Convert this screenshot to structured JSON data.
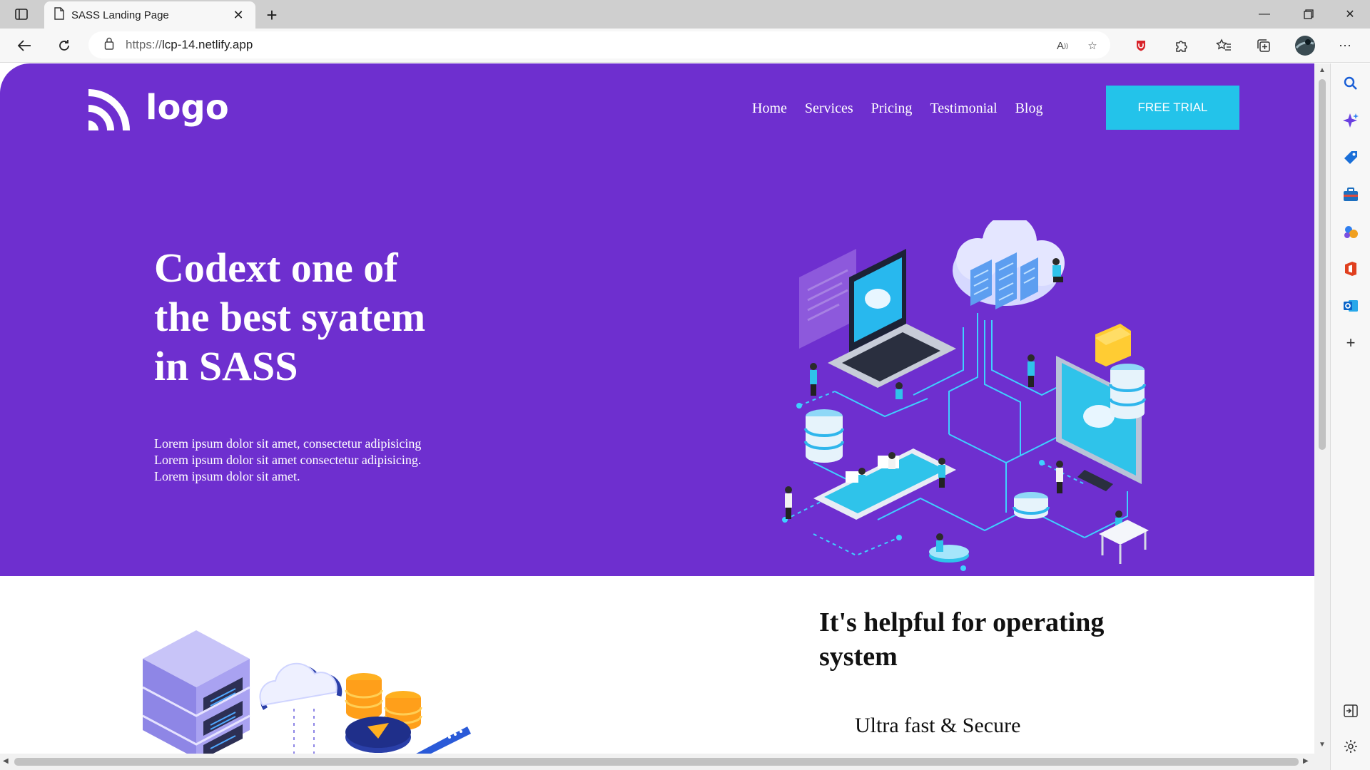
{
  "browser": {
    "tab_title": "SASS Landing Page",
    "url_protocol": "https://",
    "url_host": "lcp-14.netlify.app",
    "icons": [
      "tab-actions-icon",
      "page-icon",
      "close-icon",
      "new-tab-icon",
      "minimize-icon",
      "restore-icon",
      "window-close-icon",
      "back-icon",
      "refresh-icon",
      "lock-icon",
      "read-aloud-icon",
      "add-favorite-icon",
      "shield-extension-icon",
      "extensions-icon",
      "favorites-icon",
      "collections-icon",
      "profile-avatar",
      "more-icon"
    ]
  },
  "sidebar": {
    "icons": [
      "search-icon",
      "copilot-icon",
      "shopping-tag-icon",
      "tools-icon",
      "games-icon",
      "office-icon",
      "outlook-icon",
      "add-icon",
      "hide-sidebar-icon",
      "settings-icon"
    ]
  },
  "site": {
    "logo_text": "logo",
    "nav": [
      "Home",
      "Services",
      "Pricing",
      "Testimonial",
      "Blog"
    ],
    "cta_label": "FREE TRIAL",
    "hero": {
      "headline_lines": [
        "Codext one of",
        "the best syatem",
        "in SASS"
      ],
      "lede_lines": [
        "Lorem ipsum dolor sit amet, consectetur adipisicing",
        "Lorem ipsum dolor sit amet consectetur adipisicing.",
        "Lorem ipsum dolor sit amet."
      ]
    },
    "feature": {
      "title": "It's helpful for operating system",
      "subtitle": "Ultra fast & Secure"
    },
    "colors": {
      "hero_bg": "#6e2fcf",
      "cta_bg": "#23c3ea",
      "accent_cyan": "#2fc3ea"
    }
  }
}
